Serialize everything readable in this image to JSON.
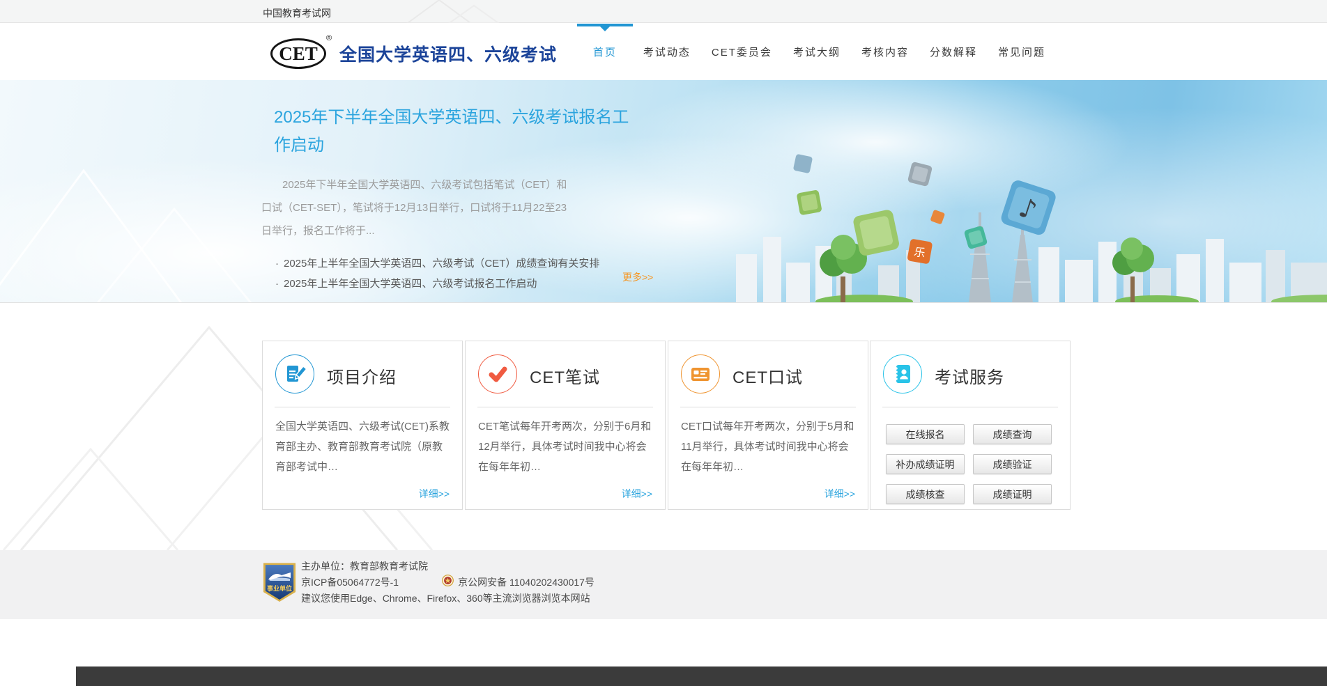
{
  "topbar": {
    "site_name": "中国教育考试网"
  },
  "header": {
    "logo_text": "CET",
    "logo_reg": "®",
    "title": "全国大学英语四、六级考试",
    "nav": [
      {
        "label": "首页",
        "active": true
      },
      {
        "label": "考试动态"
      },
      {
        "label": "CET委员会"
      },
      {
        "label": "考试大纲"
      },
      {
        "label": "考核内容"
      },
      {
        "label": "分数解释"
      },
      {
        "label": "常见问题"
      }
    ]
  },
  "hero": {
    "news_title": "2025年下半年全国大学英语四、六级考试报名工作启动",
    "news_excerpt": "2025年下半年全国大学英语四、六级考试包括笔试（CET）和口试（CET-SET），笔试将于12月13日举行，口试将于11月22至23日举行，报名工作将于...",
    "bullet_marker": "·",
    "bullets": [
      "2025年上半年全国大学英语四、六级考试（CET）成绩查询有关安排",
      "2025年上半年全国大学英语四、六级考试报名工作启动"
    ],
    "more_label": "更多>>"
  },
  "cards": [
    {
      "title": "项目介绍",
      "icon": "document-edit-icon",
      "accent": "#2196d3",
      "body": "全国大学英语四、六级考试(CET)系教育部主办、教育部教育考试院（原教育部考试中…",
      "link_label": "详细>>"
    },
    {
      "title": "CET笔试",
      "icon": "checkmark-icon",
      "accent": "#f05b41",
      "body": "CET笔试每年开考两次，分别于6月和12月举行，具体考试时间我中心将会在每年年初…",
      "link_label": "详细>>"
    },
    {
      "title": "CET口试",
      "icon": "id-card-icon",
      "accent": "#ef9430",
      "body": "CET口试每年开考两次，分别于5月和11月举行，具体考试时间我中心将会在每年年初…",
      "link_label": "详细>>"
    },
    {
      "title": "考试服务",
      "icon": "contact-book-icon",
      "accent": "#29c3e8",
      "buttons": [
        "在线报名",
        "成绩查询",
        "补办成绩证明",
        "成绩验证",
        "成绩核查",
        "成绩证明"
      ]
    }
  ],
  "footer": {
    "badge_label": "事业单位",
    "organizer": "主办单位：教育部教育考试院",
    "icp": "京ICP备05064772号-1",
    "police": "京公网安备 11040202430017号",
    "browser_tip": "建议您使用Edge、Chrome、Firefox、360等主流浏览器浏览本网站"
  },
  "colors": {
    "nav_active_blue": "#2196d3",
    "header_title_navy": "#1c4499",
    "hero_title_blue": "#2ba4de",
    "more_orange": "#f7941d",
    "card_blue": "#2196d3",
    "card_red": "#f05b41",
    "card_orange": "#ef9430",
    "card_cyan": "#29c3e8"
  }
}
